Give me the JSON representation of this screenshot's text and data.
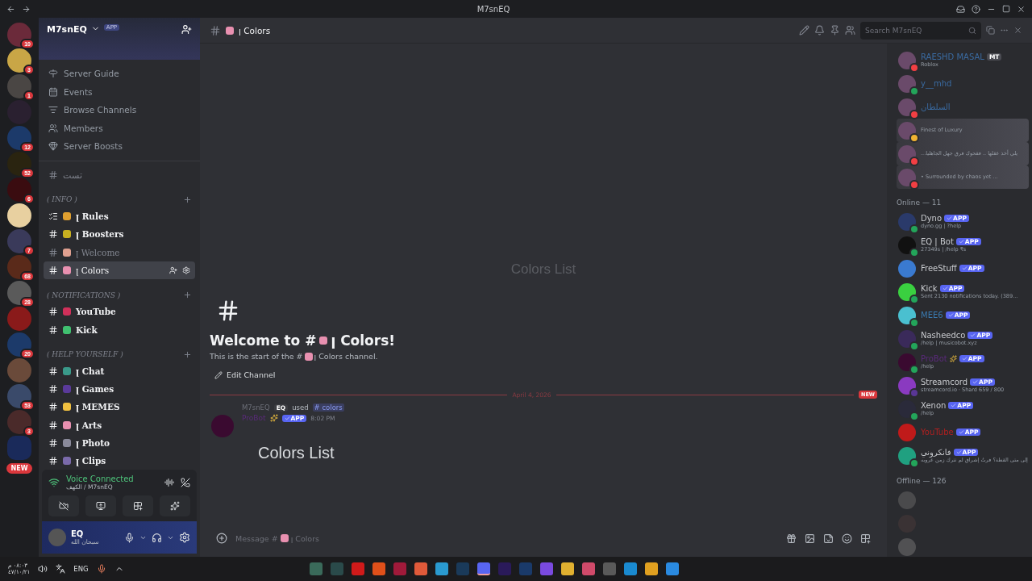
{
  "window": {
    "title": "M7snEQ"
  },
  "servers": [
    {
      "color": "#6b2a3a",
      "badge": "10",
      "selected": false
    },
    {
      "color": "#c9a646",
      "badge": "3",
      "selected": false
    },
    {
      "color": "#4a4644",
      "badge": "1",
      "selected": false
    },
    {
      "color": "#2a2030",
      "selected": false
    },
    {
      "color": "#1c3a6a",
      "badge": "12",
      "selected": false
    },
    {
      "color": "#2a2410",
      "badge": "52",
      "selected": false
    },
    {
      "color": "#3a0c10",
      "badge": "6",
      "selected": false
    },
    {
      "color": "#e8d0a0",
      "selected": false
    },
    {
      "color": "#3a3a5a",
      "badge": "7",
      "selected": false
    },
    {
      "color": "#5a2a1a",
      "badge": "68",
      "selected": false
    },
    {
      "color": "#5a5a5a",
      "badge": "28",
      "selected": false
    },
    {
      "color": "#8a1a1a",
      "selected": false
    },
    {
      "color": "#1c3a6a",
      "badge": "20",
      "selected": false
    },
    {
      "color": "#6a4a3a",
      "selected": false
    },
    {
      "color": "#3a4a6a",
      "badge": "53",
      "selected": false
    },
    {
      "color": "#4a2a2a",
      "badge": "3",
      "selected": false
    },
    {
      "color": "#1a2a5a",
      "selected": true
    }
  ],
  "new_pill": "NEW",
  "server": {
    "name": "M7snEQ",
    "app_tag": "APP"
  },
  "nav": [
    {
      "kind": "guide",
      "label": "Server Guide"
    },
    {
      "kind": "events",
      "label": "Events"
    },
    {
      "kind": "browse",
      "label": "Browse Channels"
    },
    {
      "kind": "members",
      "label": "Members"
    },
    {
      "kind": "boosts",
      "label": "Server Boosts"
    }
  ],
  "loose_channel": {
    "name": "تست"
  },
  "categories": [
    {
      "name": "( INFO )",
      "channels": [
        {
          "kind": "rules",
          "name": "ꞁ Rules",
          "color": "#e0a030",
          "selected": false,
          "unread": true
        },
        {
          "kind": "text",
          "name": "ꞁ Boosters",
          "color": "#c8b020",
          "selected": false,
          "unread": true
        },
        {
          "kind": "text",
          "name": "ꞁ Welcome",
          "color": "#e0a090",
          "selected": false,
          "unread": false
        },
        {
          "kind": "text",
          "name": "ꞁ Colors",
          "color": "#e890b0",
          "selected": true,
          "unread": true
        }
      ]
    },
    {
      "name": "( NOTIFICATIONS )",
      "channels": [
        {
          "kind": "text",
          "name": "YouTube",
          "color": "#d0305a",
          "selected": false,
          "unread": true
        },
        {
          "kind": "text",
          "name": "Kick",
          "color": "#40c070",
          "selected": false,
          "unread": true
        }
      ]
    },
    {
      "name": "( HELP YOURSELF )",
      "channels": [
        {
          "kind": "text",
          "name": "ꞁ Chat",
          "color": "#3a9a8a",
          "selected": false,
          "unread": true
        },
        {
          "kind": "text",
          "name": "ꞁ Games",
          "color": "#5a3a9a",
          "selected": false,
          "unread": true
        },
        {
          "kind": "text",
          "name": "ꞁ MEMES",
          "color": "#f0c040",
          "selected": false,
          "unread": true
        },
        {
          "kind": "text",
          "name": "ꞁ Arts",
          "color": "#e890b0",
          "selected": false,
          "unread": true
        },
        {
          "kind": "text",
          "name": "ꞁ Photo",
          "color": "#8a8a9a",
          "selected": false,
          "unread": true
        },
        {
          "kind": "text",
          "name": "ꞁ Clips",
          "color": "#7a6aaa",
          "selected": false,
          "unread": true
        }
      ]
    }
  ],
  "voice": {
    "status": "Voice Connected",
    "location": "الكهف / M7snEQ"
  },
  "user": {
    "name": "EQ",
    "status": "سبحان الله"
  },
  "channel_header": {
    "name": "ꞁ Colors"
  },
  "search": {
    "placeholder": "Search M7snEQ"
  },
  "embed_title": "Colors List",
  "welcome": {
    "title_start": "Welcome to #",
    "title_end": "ꞁ Colors!",
    "intro_start": "This is the start of the #",
    "intro_end": "ꞁ Colors channel.",
    "edit": "Edit Channel"
  },
  "divider": {
    "date": "April 4, 2026",
    "badge": "NEW"
  },
  "message": {
    "reply_author": "M7snEQ",
    "reply_tag": "EQ",
    "reply_verb": "used",
    "reply_command": "# colors",
    "author": "ProBot",
    "app_tag": "APP",
    "time": "8:02 PM",
    "content": "Colors List"
  },
  "composer": {
    "placeholder_start": "Message #",
    "placeholder_end": "ꞁ Colors"
  },
  "members_top": [
    {
      "name": "RAESHD MASAL",
      "tag": "MT",
      "activity": "Roblox",
      "color": "#3a6aa0",
      "status": {
        "color": "#f23f43"
      },
      "highlight": false
    },
    {
      "name": "y__mhd",
      "color": "#3a6aa0",
      "status": {
        "color": "#23a55a"
      },
      "highlight": false
    },
    {
      "name": "السلطان",
      "color": "#3a6aa0",
      "status": {
        "color": "#f23f43"
      },
      "highlight": false
    },
    {
      "activity": "Finest of Luxury",
      "status": {
        "color": "#f0b232"
      },
      "highlight": true
    },
    {
      "activity": "...يلي أخذ عقلها .. فقحوك فرق جهل الجاهليا",
      "status": {
        "color": "#f23f43"
      },
      "highlight": true
    },
    {
      "activity": "• Surrounded by chaos yet ...",
      "status": {
        "color": "#f23f43"
      },
      "highlight": true
    }
  ],
  "online_heading": "Online — 11",
  "bots": [
    {
      "name": "Dyno",
      "tag": "APP",
      "activity": "dyno.gg | ?help",
      "color": "#c8cace",
      "avatar": {
        "color": "#2a3a6a"
      },
      "status": {
        "color": "#23a55a"
      }
    },
    {
      "name": "EQ | Bot",
      "tag": "APP",
      "activity": "27349s | /help ₹s",
      "color": "#c8cace",
      "avatar": {
        "color": "#111111"
      },
      "status": {
        "color": "#23a55a"
      }
    },
    {
      "name": "FreeStuff",
      "tag": "APP",
      "color": "#c8cace",
      "avatar": {
        "color": "#3a7ad0"
      }
    },
    {
      "name": "Kick",
      "tag": "APP",
      "activity": "Sent 2130 notifications today. (389...",
      "color": "#c8cace",
      "avatar": {
        "color": "#3ad040"
      },
      "status": {
        "color": "#23a55a"
      }
    },
    {
      "name": "MEE6",
      "tag": "APP",
      "color": "#3a7ab0",
      "avatar": {
        "color": "#4ac0d0"
      },
      "status": {
        "color": "#23a55a"
      }
    },
    {
      "name": "Nasheedco",
      "tag": "APP",
      "activity": "/help | musicobot.xyz",
      "color": "#c8cace",
      "avatar": {
        "color": "#3a2a5a"
      },
      "status": {
        "color": "#23a55a"
      }
    },
    {
      "name": "ProBot",
      "sparkle": true,
      "tag": "APP",
      "activity": "/help",
      "color": "#5a2a7a",
      "avatar": {
        "color": "#3a0a30"
      },
      "status": {
        "color": "#23a55a"
      }
    },
    {
      "name": "Streamcord",
      "tag": "APP",
      "activity": "streamcord.io · Shard 659 / 800",
      "color": "#c8cace",
      "avatar": {
        "color": "#8a3ac0"
      },
      "status": {
        "color": "#593695"
      }
    },
    {
      "name": "Xenon",
      "tag": "APP",
      "activity": "/help",
      "color": "#c8cace",
      "avatar": {
        "color": "#2a2a3a"
      },
      "status": {
        "color": "#23a55a"
      }
    },
    {
      "name": "YouTube",
      "tag": "APP",
      "color": "#b02020",
      "avatar": {
        "color": "#c01a1a"
      }
    },
    {
      "name": "فانكروني",
      "tag": "APP",
      "activity": "إلى متى القطة؟ فرتُ إشراق لم تترك زمن عروبه",
      "color": "#c8cace",
      "avatar": {
        "color": "#20a080"
      },
      "status": {
        "color": "#23a55a"
      }
    }
  ],
  "offline_heading": "Offline — 126",
  "offline": [
    {
      "avatar": {
        "color": "#4a4a4c"
      }
    },
    {
      "avatar": {
        "color": "#3a3234"
      }
    },
    {
      "avatar": {
        "color": "#515153"
      }
    }
  ],
  "taskbar": {
    "time": "٠٨:٠٣ م",
    "date": "٤٧/١٠/٢١",
    "lang": "ENG",
    "apps": [
      {
        "color": "#3a6a5a",
        "active": false
      },
      {
        "color": "#2a4a4a",
        "active": false
      },
      {
        "color": "#d01a1a",
        "active": false
      },
      {
        "color": "#e0501a",
        "active": false
      },
      {
        "color": "#a01a3a",
        "active": false
      },
      {
        "color": "#e05a3a",
        "active": false
      },
      {
        "color": "#2a9ad0",
        "active": false
      },
      {
        "color": "#1a3a5a",
        "active": false
      },
      {
        "color": "#5865f2",
        "active": true
      },
      {
        "color": "#2a1a5a",
        "active": false
      },
      {
        "color": "#1a3a6a",
        "active": false
      },
      {
        "color": "#7a4ae0",
        "active": false
      },
      {
        "color": "#e0b030",
        "active": false
      },
      {
        "color": "#d04a6a",
        "active": false
      },
      {
        "color": "#5a5a5a",
        "active": false
      },
      {
        "color": "#1a8ad0",
        "active": false
      },
      {
        "color": "#e0a020",
        "active": false
      },
      {
        "color": "#2a8ae0",
        "active": false
      }
    ]
  }
}
